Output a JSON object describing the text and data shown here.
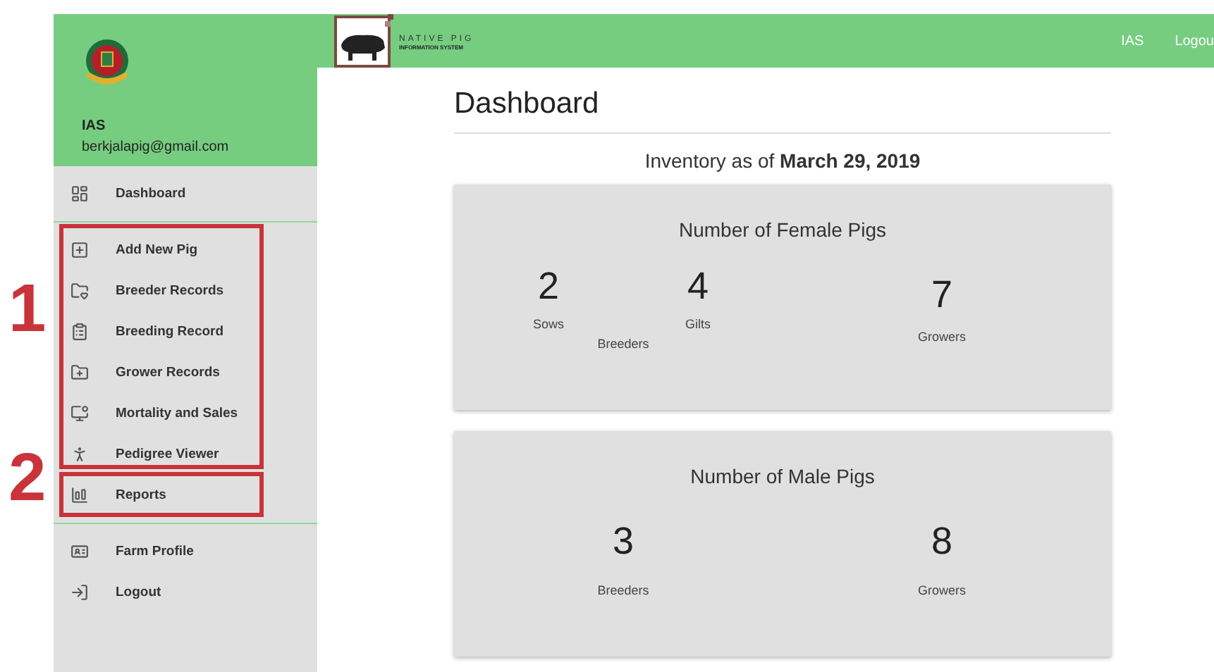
{
  "sidebar": {
    "user_name": "IAS",
    "user_email": "berkjalapig@gmail.com",
    "sections": [
      [
        "Dashboard"
      ],
      [
        "Add New Pig",
        "Breeder Records",
        "Breeding Record",
        "Grower Records",
        "Mortality and Sales",
        "Pedigree Viewer",
        "Reports"
      ],
      [
        "Farm Profile",
        "Logout"
      ]
    ]
  },
  "top_bar": {
    "logo_title": "NATIVE PIG",
    "logo_subtitle": "INFORMATION SYSTEM",
    "links": [
      "IAS",
      "Logou"
    ]
  },
  "page_title": "Dashboard",
  "inventory": "Inventory as of **March 29, 2019**",
  "cards": [
    {
      "title": "Number of Female Pigs",
      "breeders": {
        "label": "Breeders",
        "items": [
          {
            "count": "2",
            "label": "Sows"
          },
          {
            "count": "4",
            "label": "Gilts"
          }
        ]
      },
      "growers": {
        "count": "7",
        "label": "Growers"
      }
    },
    {
      "title": "Number of Male Pigs",
      "breeders": {
        "label": "Breeders",
        "count": "3"
      },
      "growers": {
        "count": "8",
        "label": "Growers"
      }
    }
  ],
  "annotations": [
    "1",
    "2"
  ]
}
